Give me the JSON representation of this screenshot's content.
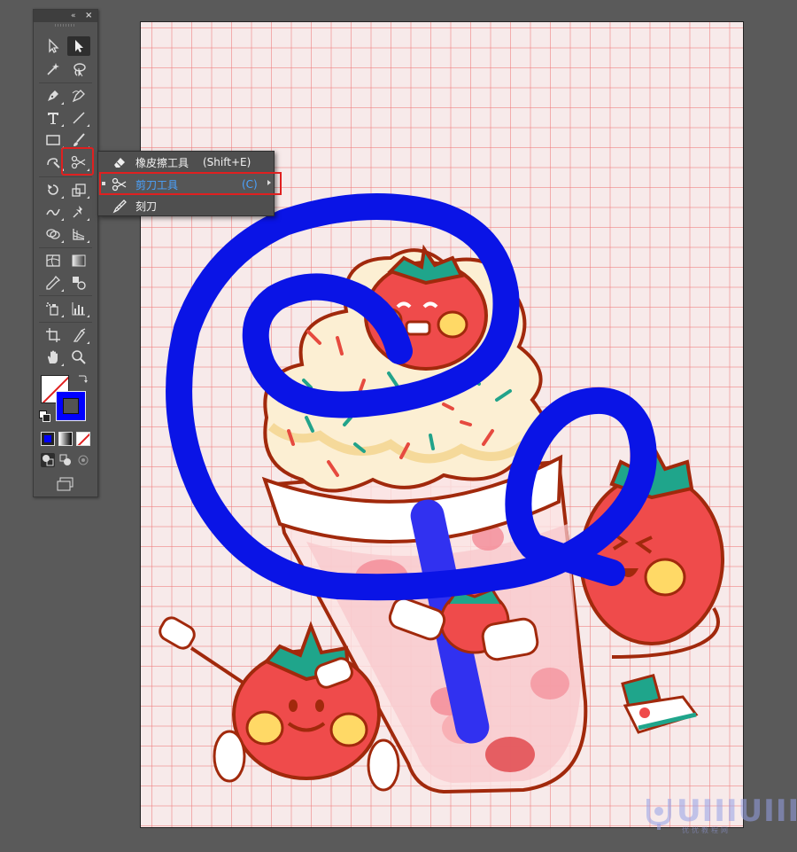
{
  "app": {
    "toolbar_collapse_glyph": "«",
    "toolbar_close_glyph": "×"
  },
  "toolbar": {
    "tools": [
      {
        "id": "selection",
        "icon": "selection-arrow-icon"
      },
      {
        "id": "direct-selection",
        "icon": "direct-selection-arrow-icon",
        "active": true
      },
      {
        "id": "magic-wand",
        "icon": "magic-wand-icon"
      },
      {
        "id": "lasso",
        "icon": "lasso-icon"
      },
      {
        "id": "pen",
        "icon": "pen-icon"
      },
      {
        "id": "curvature",
        "icon": "curvature-icon"
      },
      {
        "id": "type",
        "icon": "type-icon"
      },
      {
        "id": "line",
        "icon": "line-segment-icon"
      },
      {
        "id": "rectangle",
        "icon": "rectangle-icon"
      },
      {
        "id": "paintbrush",
        "icon": "paintbrush-icon"
      },
      {
        "id": "shaper",
        "icon": "shaper-icon"
      },
      {
        "id": "scissors",
        "icon": "scissors-icon",
        "highlighted": true
      },
      {
        "id": "rotate",
        "icon": "rotate-icon"
      },
      {
        "id": "scale",
        "icon": "scale-icon"
      },
      {
        "id": "width",
        "icon": "width-icon"
      },
      {
        "id": "puppet-warp",
        "icon": "pushpin-icon"
      },
      {
        "id": "shape-builder",
        "icon": "shape-builder-icon"
      },
      {
        "id": "perspective",
        "icon": "perspective-grid-icon"
      },
      {
        "id": "mesh",
        "icon": "mesh-icon"
      },
      {
        "id": "gradient",
        "icon": "gradient-icon"
      },
      {
        "id": "eyedropper",
        "icon": "eyedropper-icon"
      },
      {
        "id": "blend",
        "icon": "blend-icon"
      },
      {
        "id": "symbol-sprayer",
        "icon": "symbol-sprayer-icon"
      },
      {
        "id": "column-graph",
        "icon": "column-graph-icon"
      },
      {
        "id": "artboard",
        "icon": "artboard-icon"
      },
      {
        "id": "slice",
        "icon": "slice-icon"
      },
      {
        "id": "hand",
        "icon": "hand-icon"
      },
      {
        "id": "zoom",
        "icon": "zoom-icon"
      }
    ],
    "fill_color": "#ffffff",
    "stroke_color": "#0000ff"
  },
  "flyout": {
    "items": [
      {
        "label": "橡皮擦工具",
        "shortcut": "(Shift+E)",
        "icon": "eraser-icon"
      },
      {
        "label": "剪刀工具",
        "shortcut": "(C)",
        "icon": "scissors-icon",
        "selected": true
      },
      {
        "label": "刻刀",
        "shortcut": "",
        "icon": "knife-icon"
      }
    ]
  },
  "canvas": {
    "background": "#f7eaea",
    "grid_color": "#ef7878",
    "path_stroke_color": "#0a14e6"
  },
  "watermark": {
    "text": "UIIIUIII",
    "subtitle": "优优教程网"
  }
}
